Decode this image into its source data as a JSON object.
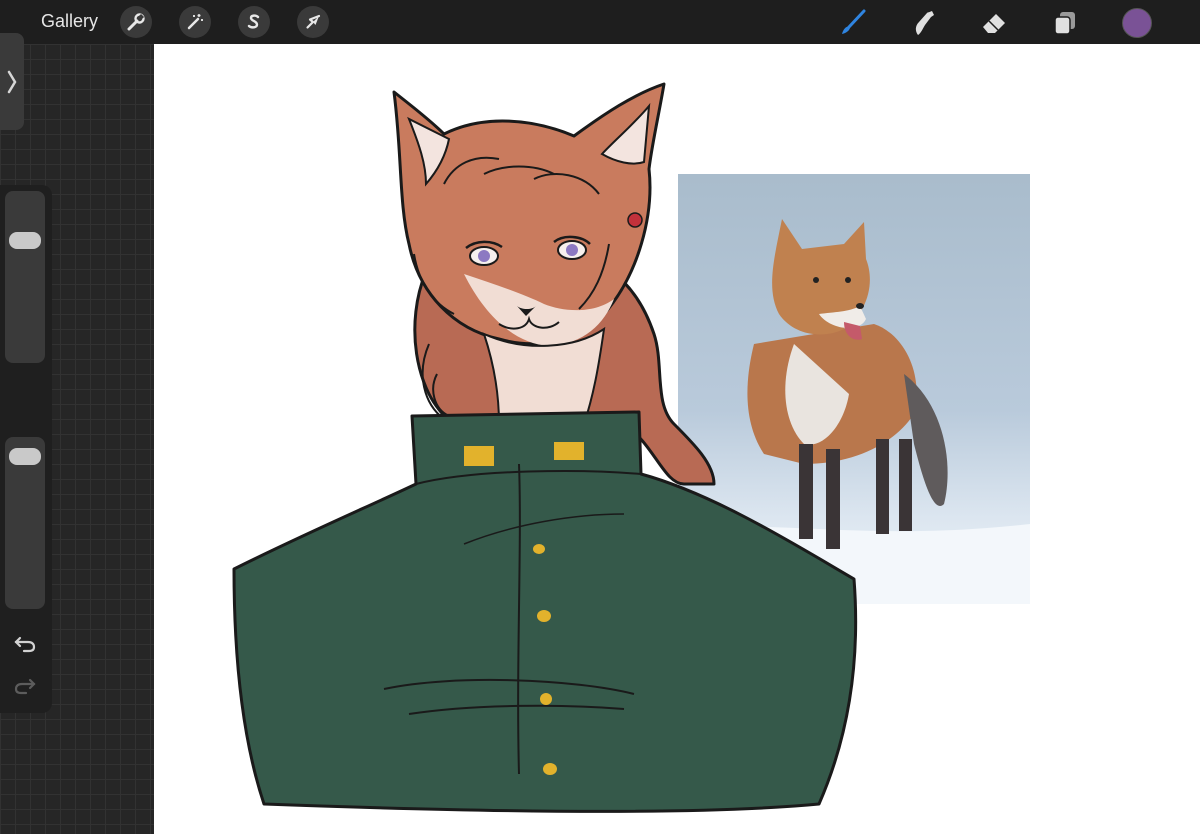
{
  "toolbar": {
    "gallery_label": "Gallery",
    "left_tools": [
      {
        "name": "actions",
        "icon": "wrench-icon"
      },
      {
        "name": "adjustments",
        "icon": "magic-wand-icon"
      },
      {
        "name": "selection",
        "icon": "selection-s-icon"
      },
      {
        "name": "transform",
        "icon": "cursor-arrow-icon"
      }
    ],
    "right_tools": [
      {
        "name": "brush",
        "icon": "brush-icon",
        "active": true
      },
      {
        "name": "smudge",
        "icon": "smudge-icon"
      },
      {
        "name": "eraser",
        "icon": "eraser-icon"
      },
      {
        "name": "layers",
        "icon": "layers-icon"
      }
    ],
    "active_color": "#7a5296",
    "active_tool_color": "#2f84e0"
  },
  "sidebar": {
    "brush_size_level": 0.75,
    "opacity_level": 0.95,
    "icons": [
      "expand-chevron-icon",
      "modify-square-icon",
      "undo-icon",
      "redo-icon"
    ]
  },
  "canvas": {
    "background": "#ffffff",
    "artwork": "fox-character-drawing",
    "reference_image": "red-fox-in-snow-photo"
  }
}
